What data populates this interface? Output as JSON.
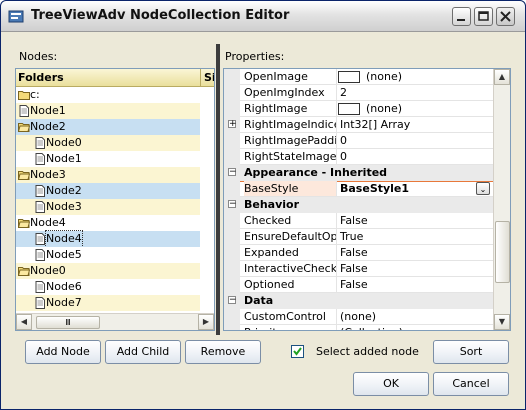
{
  "window": {
    "title": "TreeViewAdv NodeCollection Editor"
  },
  "nodes_label": "Nodes:",
  "properties_label": "Properties:",
  "tree": {
    "columns": [
      "Folders",
      "Si"
    ],
    "rows": [
      {
        "label": "c:",
        "icon": "folder-icon",
        "selected": false
      },
      {
        "label": "Node1",
        "icon": "document-icon",
        "selected": false
      },
      {
        "label": "Node2",
        "icon": "folder-open-icon",
        "selected": true
      },
      {
        "label": "Node0",
        "icon": "document-icon",
        "selected": false
      },
      {
        "label": "Node1",
        "icon": "document-icon",
        "selected": false
      },
      {
        "label": "Node3",
        "icon": "folder-open-icon",
        "selected": false
      },
      {
        "label": "Node2",
        "icon": "document-icon",
        "selected": true
      },
      {
        "label": "Node3",
        "icon": "document-icon",
        "selected": false
      },
      {
        "label": "Node4",
        "icon": "folder-open-icon",
        "selected": false
      },
      {
        "label": "Node4",
        "icon": "document-icon",
        "selected": true
      },
      {
        "label": "Node5",
        "icon": "document-icon",
        "selected": false
      },
      {
        "label": "Node0",
        "icon": "folder-open-icon",
        "selected": false
      },
      {
        "label": "Node6",
        "icon": "document-icon",
        "selected": false
      },
      {
        "label": "Node7",
        "icon": "document-icon",
        "selected": false
      }
    ],
    "hscroll_thumb": "Ⅲ"
  },
  "properties": {
    "rows": [
      {
        "type": "prop",
        "name": "OpenImage",
        "value": "(none)",
        "swatch": true
      },
      {
        "type": "prop",
        "name": "OpenImgIndex",
        "value": "2"
      },
      {
        "type": "prop",
        "name": "RightImage",
        "value": "(none)",
        "swatch": true
      },
      {
        "type": "prop",
        "name": "RightImageIndices",
        "value": "Int32[] Array",
        "expander": "+"
      },
      {
        "type": "prop",
        "name": "RightImagePadding",
        "value": "0"
      },
      {
        "type": "prop",
        "name": "RightStateImagePa",
        "value": "0"
      },
      {
        "type": "cat",
        "name": "Appearance - Inherited",
        "expander": "−"
      },
      {
        "type": "combo",
        "name": "BaseStyle",
        "value": "BaseStyle1"
      },
      {
        "type": "cat",
        "name": "Behavior",
        "expander": "−"
      },
      {
        "type": "prop",
        "name": "Checked",
        "value": "False"
      },
      {
        "type": "prop",
        "name": "EnsureDefaultOptio",
        "value": "True"
      },
      {
        "type": "prop",
        "name": "Expanded",
        "value": "False"
      },
      {
        "type": "prop",
        "name": "InteractiveCheckB",
        "value": "False"
      },
      {
        "type": "prop",
        "name": "Optioned",
        "value": "False"
      },
      {
        "type": "cat",
        "name": "Data",
        "expander": "−"
      },
      {
        "type": "prop",
        "name": "CustomControl",
        "value": "(none)"
      },
      {
        "type": "prop",
        "name": "Priority",
        "value": "(Collection)"
      }
    ]
  },
  "buttons": {
    "add_node": "Add Node",
    "add_child": "Add Child",
    "remove": "Remove",
    "sort": "Sort",
    "ok": "OK",
    "cancel": "Cancel"
  },
  "checkbox": {
    "label": "Select added node",
    "checked": true
  },
  "colors": {
    "selection": "#c7dff2",
    "tree_band": "#fbf5d2",
    "highlight_border": "#e8783a"
  }
}
